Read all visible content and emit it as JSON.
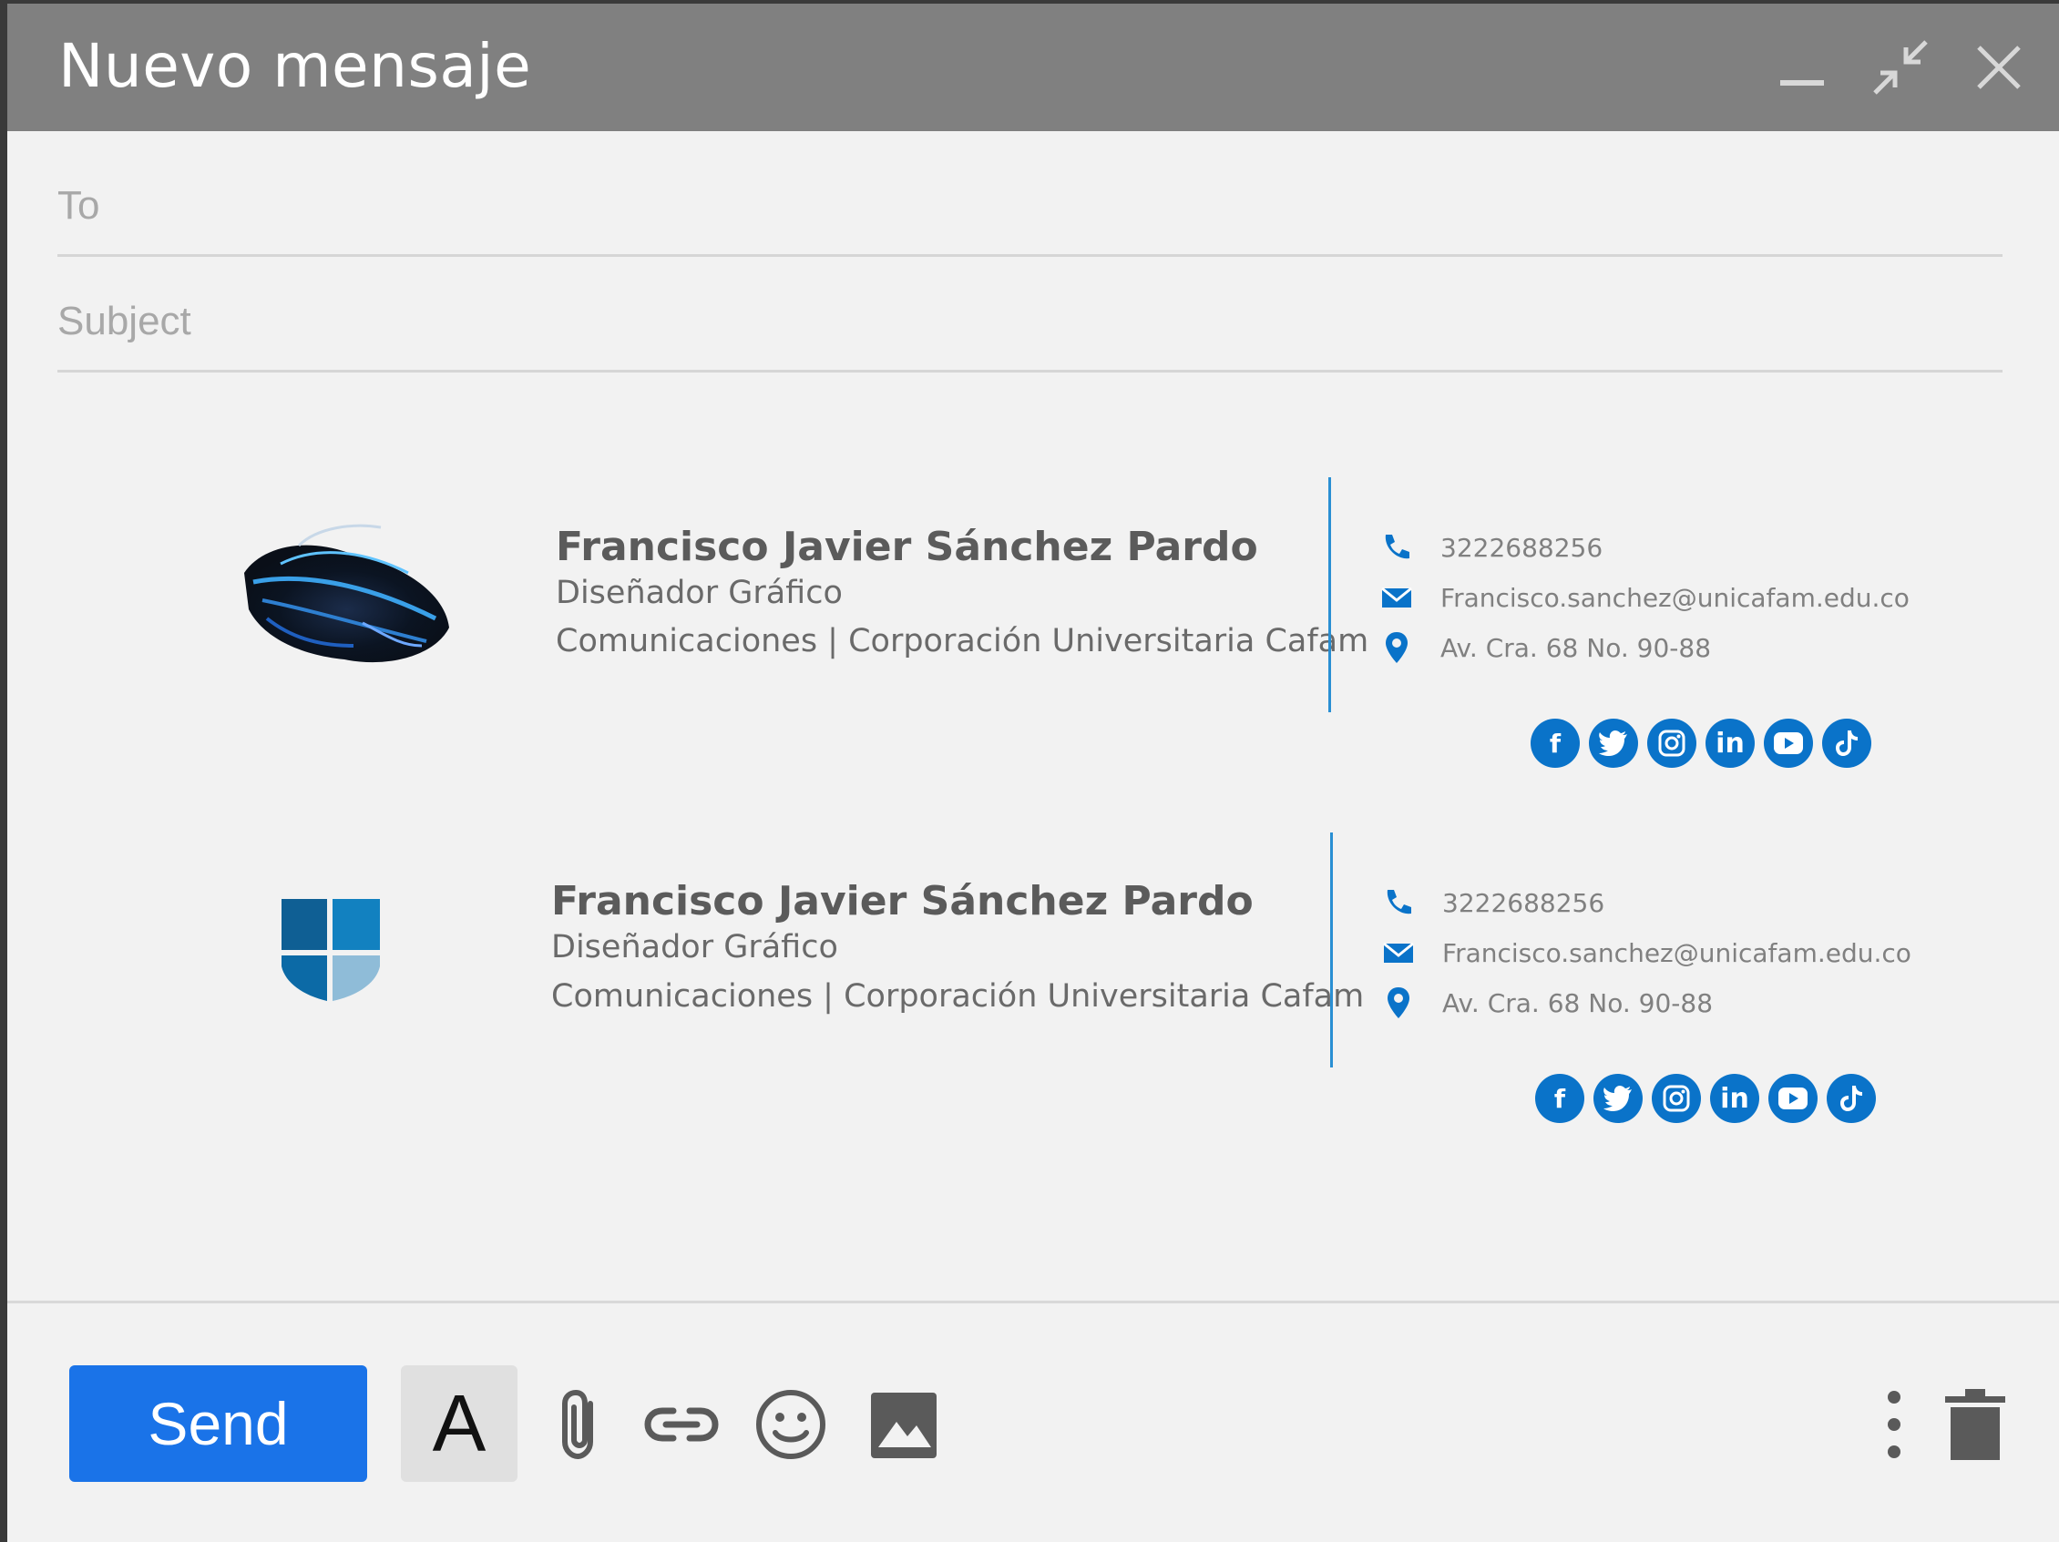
{
  "window": {
    "title": "Nuevo mensaje",
    "minimize_icon": "minimize-icon",
    "collapse_icon": "collapse-arrows-icon",
    "close_icon": "close-icon"
  },
  "fields": {
    "to_placeholder": "To",
    "to_value": "",
    "subject_placeholder": "Subject",
    "subject_value": ""
  },
  "signatures": [
    {
      "logo": "abstract-feather-logo",
      "name": "Francisco Javier Sánchez Pardo",
      "role": "Diseñador Gráfico",
      "dept": "Comunicaciones | Corporación Universitaria Cafam",
      "phone": "3222688256",
      "email": "Francisco.sanchez@unicafam.edu.co",
      "address": "Av. Cra. 68 No. 90-88",
      "accent": "#0a73c9",
      "socials": [
        "f",
        "t",
        "ig",
        "in",
        "yt",
        "tk"
      ]
    },
    {
      "logo": "shield-logo",
      "name": "Francisco Javier Sánchez Pardo",
      "role": "Diseñador Gráfico",
      "dept": "Comunicaciones | Corporación Universitaria Cafam",
      "phone": "3222688256",
      "email": "Francisco.sanchez@unicafam.edu.co",
      "address": "Av. Cra. 68 No. 90-88",
      "accent": "#0a73c9",
      "socials": [
        "f",
        "t",
        "ig",
        "in",
        "yt",
        "tk"
      ]
    }
  ],
  "toolbar": {
    "send_label": "Send",
    "format_label": "A",
    "attach_icon": "paperclip-icon",
    "link_icon": "link-icon",
    "emoji_icon": "emoji-icon",
    "image_icon": "image-icon",
    "more_icon": "more-vert-icon",
    "delete_icon": "trash-icon"
  },
  "colors": {
    "titlebar": "#808080",
    "send": "#1a73e8",
    "brand_blue": "#0a73c9"
  }
}
